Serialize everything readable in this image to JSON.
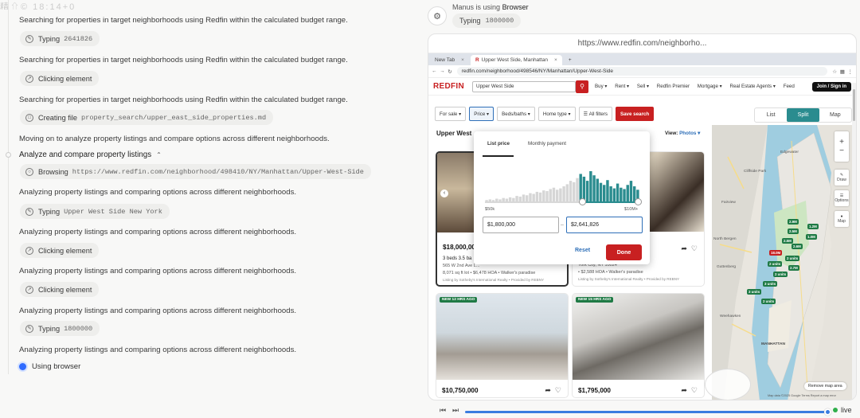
{
  "left": {
    "top_chip_text": "精⇧© 18:14+0",
    "status_label": "Using browser",
    "steps": [
      {
        "text": "Searching for properties in target neighborhoods using Redfin within the calculated budget range.",
        "chip_action": "Typing",
        "chip_value": "2641826"
      },
      {
        "text": "Searching for properties in target neighborhoods using Redfin within the calculated budget range.",
        "chip_action": "Clicking element",
        "chip_value": ""
      },
      {
        "text": "Searching for properties in target neighborhoods using Redfin within the calculated budget range.",
        "chip_action": "Creating file",
        "chip_value": "property_search/upper_east_side_properties.md"
      },
      {
        "text": "Moving on to analyze property listings and compare options across different neighborhoods.",
        "chip_action": "",
        "chip_value": ""
      }
    ],
    "section_title": "Analyze and compare property listings",
    "section_steps": [
      {
        "chip_action": "Browsing",
        "chip_value": "https://www.redfin.com/neighborhood/498410/NY/Manhattan/Upper-West-Side",
        "text": "Analyzing property listings and comparing options across different neighborhoods."
      },
      {
        "chip_action": "Typing",
        "chip_value": "Upper West Side New York",
        "text": "Analyzing property listings and comparing options across different neighborhoods."
      },
      {
        "chip_action": "Clicking element",
        "chip_value": "",
        "text": "Analyzing property listings and comparing options across different neighborhoods."
      },
      {
        "chip_action": "Clicking element",
        "chip_value": "",
        "text": "Analyzing property listings and comparing options across different neighborhoods."
      },
      {
        "chip_action": "Typing",
        "chip_value": "1800000",
        "text": "Analyzing property listings and comparing options across different neighborhoods."
      }
    ]
  },
  "agent": {
    "name": "Manus",
    "using_prefix": "is using",
    "tool": "Browser",
    "chip_action": "Typing",
    "chip_value": "1800000"
  },
  "browser": {
    "window_url": "https://www.redfin.com/neighborho...",
    "tabs": [
      {
        "label": "New Tab",
        "active": false
      },
      {
        "label": "Upper West Side, Manhattan",
        "active": true
      }
    ],
    "address": "redfin.com/neighborhood/498546/NY/Manhattan/Upper-West-Side",
    "redfin": {
      "logo": "REDFIN",
      "search_value": "Upper West Side",
      "menu": [
        "Buy ▾",
        "Rent ▾",
        "Sell ▾",
        "Redfin Premier",
        "Mortgage ▾",
        "Real Estate Agents ▾",
        "Feed"
      ],
      "join_label": "Join / Sign in",
      "filters": [
        "For sale ▾",
        "Price ▾",
        "Beds/baths ▾",
        "Home type ▾",
        "☰ All filters"
      ],
      "save_search": "Save search",
      "view_toggle": [
        "List",
        "Split",
        "Map"
      ],
      "view_active": "Split",
      "list_heading": "Upper West",
      "view_label": "View:",
      "view_value": "Photos ▾"
    },
    "price_popup": {
      "tab_list": "List price",
      "tab_monthly": "Monthly payment",
      "min_label": "$50k",
      "max_label": "$10M+",
      "min_value": "$1,800,000",
      "max_value": "$2,641,826",
      "reset": "Reset",
      "done": "Done",
      "histogram": [
        2,
        3,
        2,
        4,
        3,
        5,
        4,
        6,
        5,
        8,
        7,
        10,
        9,
        12,
        11,
        14,
        13,
        16,
        15,
        18,
        20,
        17,
        19,
        22,
        25,
        30,
        28,
        34,
        40,
        36,
        30,
        44,
        38,
        33,
        27,
        24,
        31,
        22,
        19,
        26,
        20,
        18,
        24,
        30,
        22,
        17
      ]
    },
    "cards": [
      {
        "price": "$18,000,000",
        "line1": "3 beds  3.5 ba",
        "line2": "565 W 2nd Ave L...",
        "line3": "8,071 sq ft lot • $6,478 HOA • Walker's paradise",
        "line4": "Listing by Sotheby's International Realty • Provided by REBNY",
        "badge": ""
      },
      {
        "price": "",
        "line1": "",
        "line2": "York City, NY 10024",
        "line3": "• $2,588 HOA • Walker's paradise",
        "line4": "Listing by Sotheby's International Realty • Provided by REBNY",
        "badge": ""
      },
      {
        "price": "$10,750,000",
        "line1": "",
        "line2": "",
        "line3": "",
        "line4": "",
        "badge": "NEW 12 HRS AGO"
      },
      {
        "price": "$1,795,000",
        "line1": "",
        "line2": "",
        "line3": "",
        "line4": "",
        "badge": "NEW 15 HRS AGO"
      }
    ],
    "map": {
      "labels": [
        "Edgewater",
        "Cliffside Park",
        "Fairview",
        "North Bergen",
        "Guttenberg",
        "MANHATTAN",
        "Weehawken"
      ],
      "pins": [
        "2.9M",
        "1.2M",
        "2.5M",
        "1.0M",
        "2.5M",
        "2.6M",
        "18.0M",
        "2 units",
        "2 units",
        "2.7M",
        "2 units",
        "3 units",
        "3 units",
        "2 units"
      ],
      "controls": [
        "+",
        "−",
        "Draw",
        "Options",
        "Map"
      ],
      "remove_label": "Remove map area",
      "footer": "Map data ©2025 Google   Terms   Report a map error"
    }
  },
  "player": {
    "live_label": "live"
  }
}
